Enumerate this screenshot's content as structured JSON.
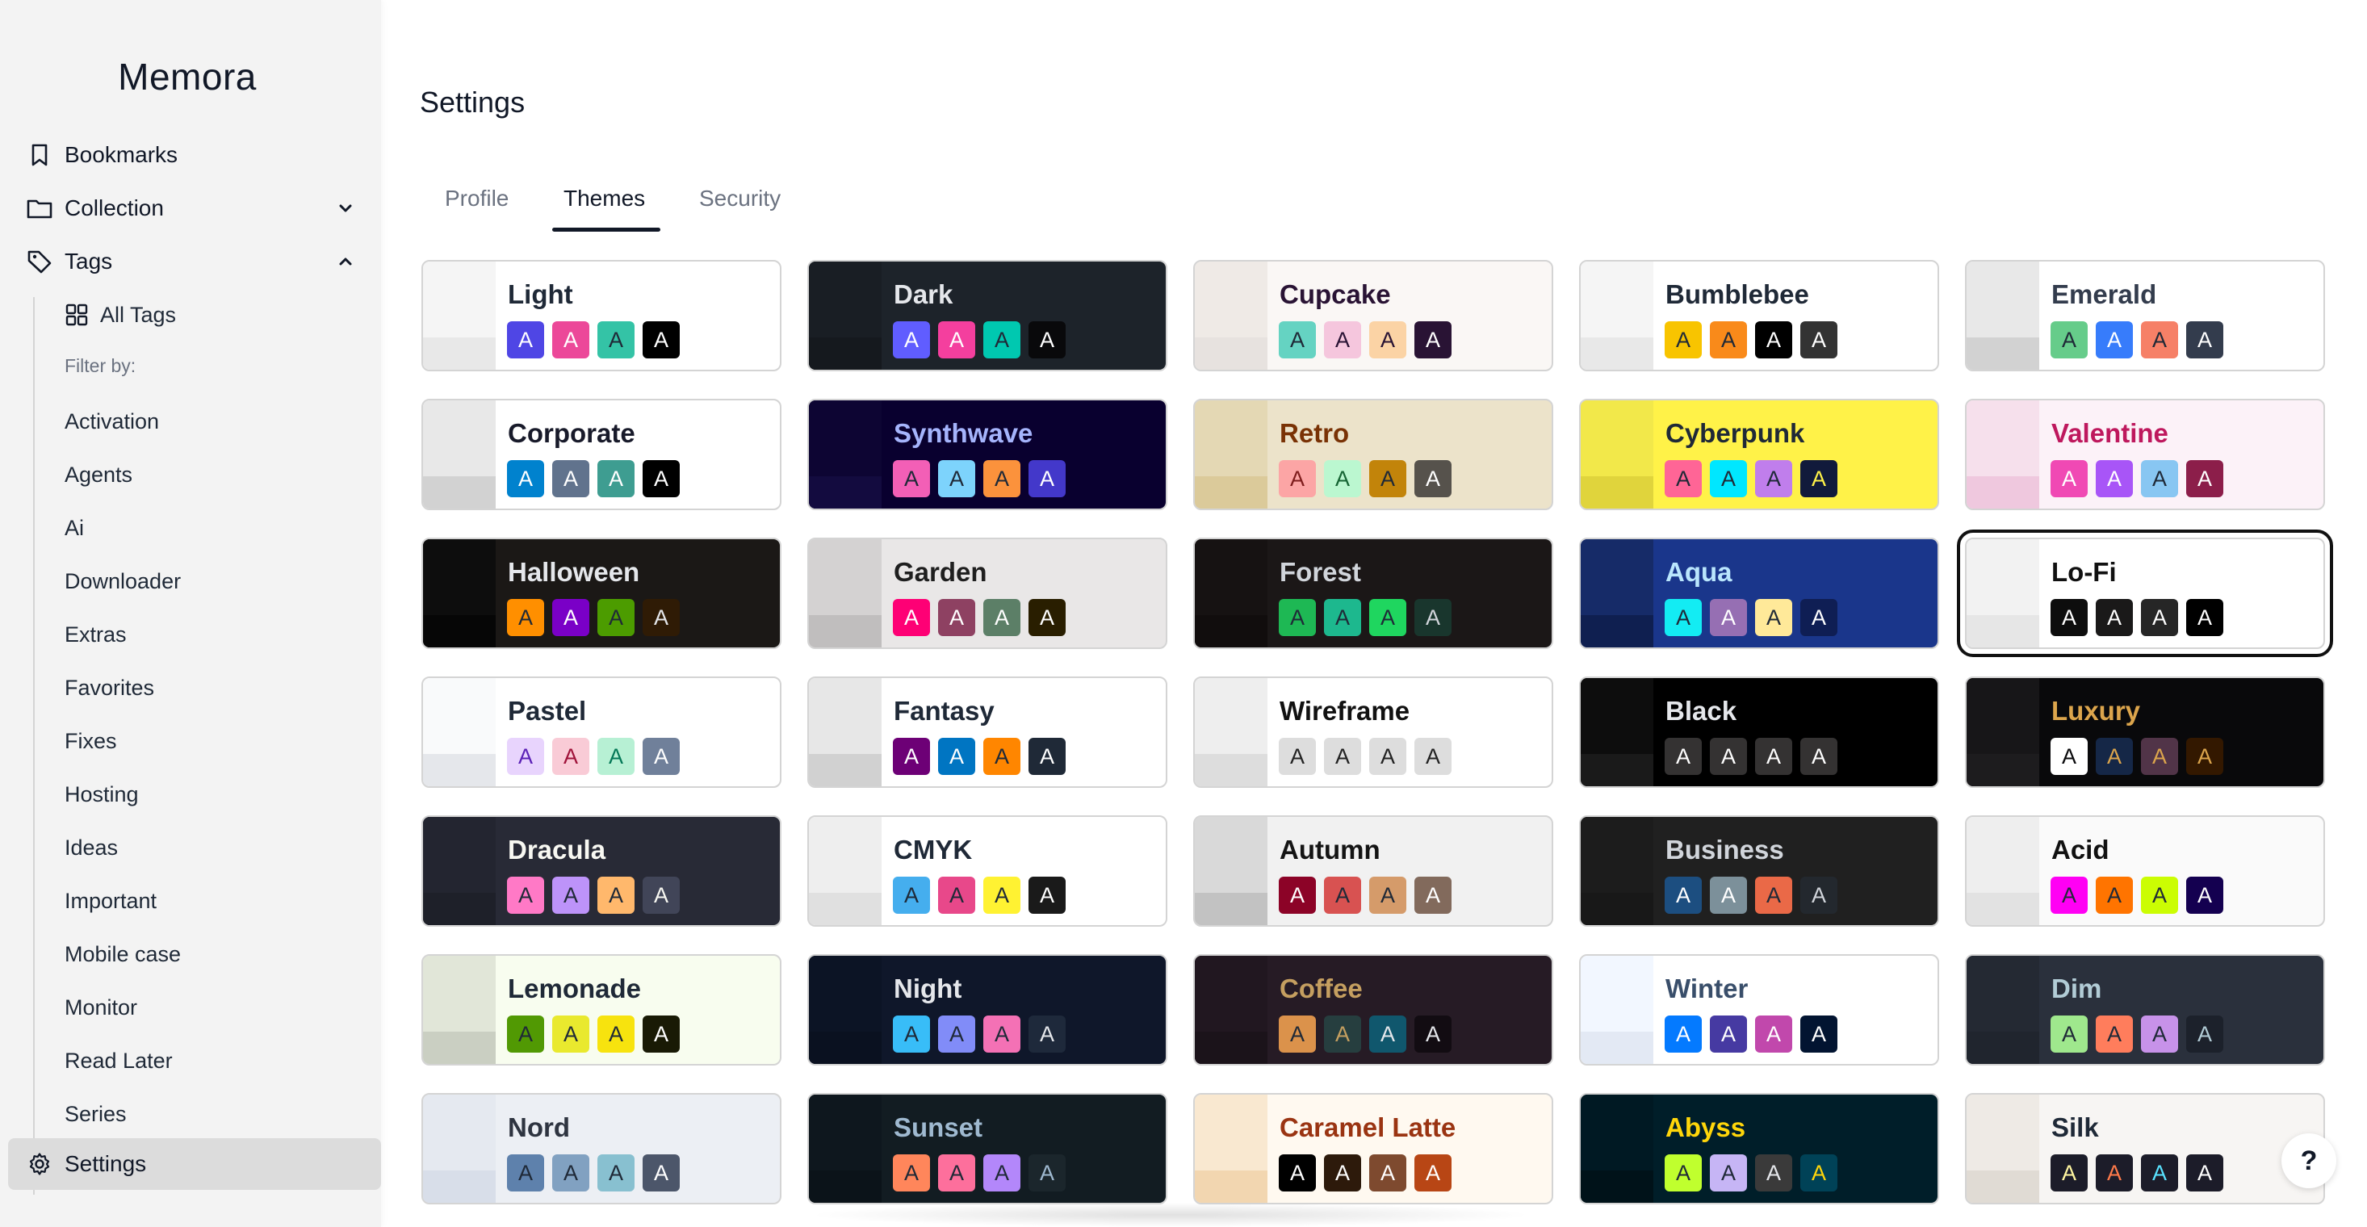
{
  "app": {
    "name": "Memora"
  },
  "sidebar": {
    "bookmarks": "Bookmarks",
    "collection": "Collection",
    "tags": "Tags",
    "all_tags": "All Tags",
    "filter_by": "Filter by:",
    "tag_items": [
      "Activation",
      "Agents",
      "Ai",
      "Downloader",
      "Extras",
      "Favorites",
      "Fixes",
      "Hosting",
      "Ideas",
      "Important",
      "Mobile case",
      "Monitor",
      "Read Later",
      "Series"
    ],
    "settings": "Settings"
  },
  "page": {
    "title": "Settings"
  },
  "tabs": [
    {
      "label": "Profile",
      "active": false
    },
    {
      "label": "Themes",
      "active": true
    },
    {
      "label": "Security",
      "active": false
    }
  ],
  "swatch_letter": "A",
  "help_label": "?",
  "themes": [
    {
      "name": "Light",
      "bg": "#ffffff",
      "text": "#1f2937",
      "strip": [
        "#f5f5f5",
        "#e8e8e8"
      ],
      "sw": [
        [
          "#4f46e5",
          "#fff"
        ],
        [
          "#ec4899",
          "#fff"
        ],
        [
          "#34c3a6",
          "#1f2937"
        ],
        [
          "#000000",
          "#fff"
        ]
      ]
    },
    {
      "name": "Dark",
      "bg": "#1d232a",
      "text": "#e5e7eb",
      "strip": [
        "#191e24",
        "#15191e"
      ],
      "sw": [
        [
          "#605dff",
          "#fff"
        ],
        [
          "#f43f9e",
          "#fff"
        ],
        [
          "#00c8b0",
          "#1f2937"
        ],
        [
          "#09090b",
          "#fff"
        ]
      ]
    },
    {
      "name": "Cupcake",
      "bg": "#faf7f5",
      "text": "#291334",
      "strip": [
        "#efeae6",
        "#e7e2df"
      ],
      "sw": [
        [
          "#65d3c2",
          "#1f2937"
        ],
        [
          "#f5c6dd",
          "#291334"
        ],
        [
          "#fbd3a5",
          "#291334"
        ],
        [
          "#291334",
          "#fff"
        ]
      ]
    },
    {
      "name": "Bumblebee",
      "bg": "#ffffff",
      "text": "#1f2937",
      "strip": [
        "#f5f5f5",
        "#e8e8e8"
      ],
      "sw": [
        [
          "#f8c400",
          "#1f2937"
        ],
        [
          "#f98a1a",
          "#1f2937"
        ],
        [
          "#000000",
          "#fff"
        ],
        [
          "#333333",
          "#fff"
        ]
      ]
    },
    {
      "name": "Emerald",
      "bg": "#ffffff",
      "text": "#333c4d",
      "strip": [
        "#e8e8e8",
        "#d2d2d2"
      ],
      "sw": [
        [
          "#66cc8a",
          "#1f2937"
        ],
        [
          "#377cfb",
          "#fff"
        ],
        [
          "#f68067",
          "#1f2937"
        ],
        [
          "#333c4d",
          "#fff"
        ]
      ]
    },
    {
      "name": "Corporate",
      "bg": "#ffffff",
      "text": "#181a2a",
      "strip": [
        "#e8e8e8",
        "#d2d2d2"
      ],
      "sw": [
        [
          "#0082ce",
          "#fff"
        ],
        [
          "#61738d",
          "#fff"
        ],
        [
          "#3e9d91",
          "#fff"
        ],
        [
          "#000000",
          "#fff"
        ]
      ]
    },
    {
      "name": "Synthwave",
      "bg": "#09002f",
      "text": "#a5b4fc",
      "strip": [
        "#0d0533",
        "#130b3f"
      ],
      "sw": [
        [
          "#f35fb6",
          "#1f2937"
        ],
        [
          "#7dd3fc",
          "#1f2937"
        ],
        [
          "#fb923c",
          "#1f2937"
        ],
        [
          "#4338ca",
          "#fff"
        ]
      ]
    },
    {
      "name": "Retro",
      "bg": "#ece3ca",
      "text": "#793205",
      "strip": [
        "#e4d8b4",
        "#dbca9a"
      ],
      "sw": [
        [
          "#fca5a5",
          "#7f1d1d"
        ],
        [
          "#bbf7d0",
          "#166534"
        ],
        [
          "#c2840a",
          "#1f2937"
        ],
        [
          "#56524c",
          "#fff"
        ]
      ]
    },
    {
      "name": "Cyberpunk",
      "bg": "#fff248",
      "text": "#1f2937",
      "strip": [
        "#f2e84a",
        "#e0d43c"
      ],
      "sw": [
        [
          "#ff6596",
          "#1f2937"
        ],
        [
          "#00e7ff",
          "#1f2937"
        ],
        [
          "#c07eec",
          "#1f2937"
        ],
        [
          "#111a3b",
          "#fff248"
        ]
      ]
    },
    {
      "name": "Valentine",
      "bg": "#fcf2f8",
      "text": "#be185d",
      "strip": [
        "#f6e0ec",
        "#efc8de"
      ],
      "sw": [
        [
          "#f049b4",
          "#fff"
        ],
        [
          "#a855f7",
          "#fff"
        ],
        [
          "#88c6f2",
          "#1f2937"
        ],
        [
          "#8c1e4a",
          "#fff"
        ]
      ]
    },
    {
      "name": "Halloween",
      "bg": "#1b1816",
      "text": "#e5e7eb",
      "strip": [
        "#0d0d0d",
        "#060606"
      ],
      "sw": [
        [
          "#ff8f00",
          "#1f2937"
        ],
        [
          "#7a00c7",
          "#fff"
        ],
        [
          "#4c9c00",
          "#1f2937"
        ],
        [
          "#2f1b05",
          "#e5e7eb"
        ]
      ]
    },
    {
      "name": "Garden",
      "bg": "#e9e7e7",
      "text": "#1f1f1f",
      "strip": [
        "#d4d2d2",
        "#c0bebe"
      ],
      "sw": [
        [
          "#fe0075",
          "#fff"
        ],
        [
          "#8e4162",
          "#fff"
        ],
        [
          "#5c7f67",
          "#fff"
        ],
        [
          "#291e00",
          "#fff"
        ]
      ]
    },
    {
      "name": "Forest",
      "bg": "#1b1717",
      "text": "#d1d5db",
      "strip": [
        "#161212",
        "#110d0d"
      ],
      "sw": [
        [
          "#1eb854",
          "#1f2937"
        ],
        [
          "#1db88e",
          "#1f2937"
        ],
        [
          "#1fd65f",
          "#1f2937"
        ],
        [
          "#19362d",
          "#d1d5db"
        ]
      ]
    },
    {
      "name": "Aqua",
      "bg": "#1a368b",
      "text": "#bae6fd",
      "strip": [
        "#162b68",
        "#0f1f50"
      ],
      "sw": [
        [
          "#13ecf3",
          "#1f2937"
        ],
        [
          "#966fb3",
          "#fff"
        ],
        [
          "#ffe999",
          "#1f2937"
        ],
        [
          "#0f1e54",
          "#fff"
        ]
      ]
    },
    {
      "name": "Lo-Fi",
      "bg": "#ffffff",
      "text": "#111111",
      "strip": [
        "#f2f2f2",
        "#e6e6e6"
      ],
      "sw": [
        [
          "#0d0d0d",
          "#fff"
        ],
        [
          "#1a1919",
          "#fff"
        ],
        [
          "#262626",
          "#fff"
        ],
        [
          "#000000",
          "#fff"
        ]
      ]
    },
    {
      "name": "Pastel",
      "bg": "#ffffff",
      "text": "#1f2937",
      "strip": [
        "#f9fafb",
        "#e5e7eb"
      ],
      "sw": [
        [
          "#e8d4fd",
          "#5b21b6"
        ],
        [
          "#f9cbd6",
          "#9f1239"
        ],
        [
          "#b7f0d4",
          "#047857"
        ],
        [
          "#70809a",
          "#fff"
        ]
      ]
    },
    {
      "name": "Fantasy",
      "bg": "#ffffff",
      "text": "#1f2937",
      "strip": [
        "#e7e7e7",
        "#d1d1d1"
      ],
      "sw": [
        [
          "#6d0076",
          "#fff"
        ],
        [
          "#0075c2",
          "#fff"
        ],
        [
          "#ff8600",
          "#1f2937"
        ],
        [
          "#1f2937",
          "#fff"
        ]
      ]
    },
    {
      "name": "Wireframe",
      "bg": "#ffffff",
      "text": "#111111",
      "strip": [
        "#eeeeee",
        "#dddddd"
      ],
      "sw": [
        [
          "#dddddd",
          "#222"
        ],
        [
          "#dddddd",
          "#222"
        ],
        [
          "#dddddd",
          "#222"
        ],
        [
          "#dddddd",
          "#222"
        ]
      ]
    },
    {
      "name": "Black",
      "bg": "#000000",
      "text": "#e5e7eb",
      "strip": [
        "#0d0d0d",
        "#1a1a1a"
      ],
      "sw": [
        [
          "#343232",
          "#fff"
        ],
        [
          "#343232",
          "#fff"
        ],
        [
          "#343232",
          "#fff"
        ],
        [
          "#343232",
          "#fff"
        ]
      ]
    },
    {
      "name": "Luxury",
      "bg": "#09090b",
      "text": "#dca54c",
      "strip": [
        "#171618",
        "#1d1c1e"
      ],
      "sw": [
        [
          "#ffffff",
          "#09090b"
        ],
        [
          "#152747",
          "#dca54c"
        ],
        [
          "#513448",
          "#dca54c"
        ],
        [
          "#331800",
          "#dca54c"
        ]
      ]
    },
    {
      "name": "Dracula",
      "bg": "#282a36",
      "text": "#f8f8f2",
      "strip": [
        "#232530",
        "#1e2029"
      ],
      "sw": [
        [
          "#ff79c6",
          "#1f2937"
        ],
        [
          "#bd93f9",
          "#1f2937"
        ],
        [
          "#ffb86c",
          "#1f2937"
        ],
        [
          "#414558",
          "#f8f8f2"
        ]
      ]
    },
    {
      "name": "CMYK",
      "bg": "#ffffff",
      "text": "#1f2937",
      "strip": [
        "#eeeeee",
        "#e0e0e0"
      ],
      "sw": [
        [
          "#45aeee",
          "#1f2937"
        ],
        [
          "#e8488a",
          "#1f2937"
        ],
        [
          "#fff232",
          "#1f2937"
        ],
        [
          "#1a1a1a",
          "#fff"
        ]
      ]
    },
    {
      "name": "Autumn",
      "bg": "#f1f1f1",
      "text": "#141414",
      "strip": [
        "#d9d9d9",
        "#c2c2c2"
      ],
      "sw": [
        [
          "#8c0327",
          "#fff"
        ],
        [
          "#d85251",
          "#1f2937"
        ],
        [
          "#d59b6a",
          "#1f2937"
        ],
        [
          "#826a5c",
          "#fff"
        ]
      ]
    },
    {
      "name": "Business",
      "bg": "#202020",
      "text": "#d1d5db",
      "strip": [
        "#1c1c1c",
        "#181818"
      ],
      "sw": [
        [
          "#1c4e80",
          "#fff"
        ],
        [
          "#7c909a",
          "#fff"
        ],
        [
          "#ea6947",
          "#1f2937"
        ],
        [
          "#23282e",
          "#d1d5db"
        ]
      ]
    },
    {
      "name": "Acid",
      "bg": "#fafafa",
      "text": "#111111",
      "strip": [
        "#eeeeee",
        "#e2e2e2"
      ],
      "sw": [
        [
          "#ff00f4",
          "#1f2937"
        ],
        [
          "#ff7400",
          "#1f2937"
        ],
        [
          "#cbfd03",
          "#1f2937"
        ],
        [
          "#140050",
          "#fff"
        ]
      ]
    },
    {
      "name": "Lemonade",
      "bg": "#f8fdef",
      "text": "#1f2937",
      "strip": [
        "#e1e6d8",
        "#cacfc2"
      ],
      "sw": [
        [
          "#519903",
          "#1f2937"
        ],
        [
          "#e9e92e",
          "#1f2937"
        ],
        [
          "#f7e30e",
          "#1f2937"
        ],
        [
          "#191a05",
          "#fff"
        ]
      ]
    },
    {
      "name": "Night",
      "bg": "#0f172a",
      "text": "#e5e7eb",
      "strip": [
        "#0c1425",
        "#0a1120"
      ],
      "sw": [
        [
          "#38bdf8",
          "#1f2937"
        ],
        [
          "#818cf8",
          "#1f2937"
        ],
        [
          "#f471b5",
          "#1f2937"
        ],
        [
          "#1e293b",
          "#e5e7eb"
        ]
      ]
    },
    {
      "name": "Coffee",
      "bg": "#261b25",
      "text": "#c59f60",
      "strip": [
        "#211720",
        "#1b131a"
      ],
      "sw": [
        [
          "#db924b",
          "#1f2937"
        ],
        [
          "#263e3f",
          "#c59f60"
        ],
        [
          "#10576d",
          "#e5e7eb"
        ],
        [
          "#120c12",
          "#e5e7eb"
        ]
      ]
    },
    {
      "name": "Winter",
      "bg": "#ffffff",
      "text": "#394e6a",
      "strip": [
        "#f2f7ff",
        "#e3e9f4"
      ],
      "sw": [
        [
          "#047aff",
          "#fff"
        ],
        [
          "#463aa2",
          "#fff"
        ],
        [
          "#c148ac",
          "#fff"
        ],
        [
          "#021431",
          "#fff"
        ]
      ]
    },
    {
      "name": "Dim",
      "bg": "#2a303c",
      "text": "#b2ccd6",
      "strip": [
        "#242933",
        "#20252e"
      ],
      "sw": [
        [
          "#9fe88d",
          "#1f2937"
        ],
        [
          "#ff7d5c",
          "#1f2937"
        ],
        [
          "#c792e9",
          "#1f2937"
        ],
        [
          "#1c212b",
          "#b2ccd6"
        ]
      ]
    },
    {
      "name": "Nord",
      "bg": "#eceff4",
      "text": "#2e3440",
      "strip": [
        "#e5e9f0",
        "#d8dee9"
      ],
      "sw": [
        [
          "#5e81ac",
          "#1f2937"
        ],
        [
          "#81a1c1",
          "#1f2937"
        ],
        [
          "#88c0d0",
          "#1f2937"
        ],
        [
          "#4c566a",
          "#fff"
        ]
      ]
    },
    {
      "name": "Sunset",
      "bg": "#121c22",
      "text": "#9fb9d0",
      "strip": [
        "#0e171e",
        "#0b1319"
      ],
      "sw": [
        [
          "#ff865b",
          "#1f2937"
        ],
        [
          "#fd6f9c",
          "#1f2937"
        ],
        [
          "#b387fa",
          "#1f2937"
        ],
        [
          "#1b262c",
          "#9fb9d0"
        ]
      ]
    },
    {
      "name": "Caramel Latte",
      "bg": "#fff9f0",
      "text": "#9a3412",
      "strip": [
        "#f9e8d0",
        "#f2d6b0"
      ],
      "sw": [
        [
          "#000000",
          "#fff"
        ],
        [
          "#2d1a0b",
          "#fff"
        ],
        [
          "#7e4a2f",
          "#fff"
        ],
        [
          "#b84615",
          "#fff"
        ]
      ]
    },
    {
      "name": "Abyss",
      "bg": "#001e29",
      "text": "#ffd60a",
      "strip": [
        "#001923",
        "#001219"
      ],
      "sw": [
        [
          "#c0ff2e",
          "#1f2937"
        ],
        [
          "#c6b5f5",
          "#1f2937"
        ],
        [
          "#3a3a3a",
          "#e5e7eb"
        ],
        [
          "#004257",
          "#ffd60a"
        ]
      ]
    },
    {
      "name": "Silk",
      "bg": "#f7f5f3",
      "text": "#1f2937",
      "strip": [
        "#eeeae5",
        "#e0dbd4"
      ],
      "sw": [
        [
          "#1c1c29",
          "#fff6a1"
        ],
        [
          "#1c1c29",
          "#ff7a4a"
        ],
        [
          "#1c1c29",
          "#59e3ff"
        ],
        [
          "#1c1c29",
          "#fff"
        ]
      ]
    }
  ],
  "selected_theme": "Lo-Fi"
}
